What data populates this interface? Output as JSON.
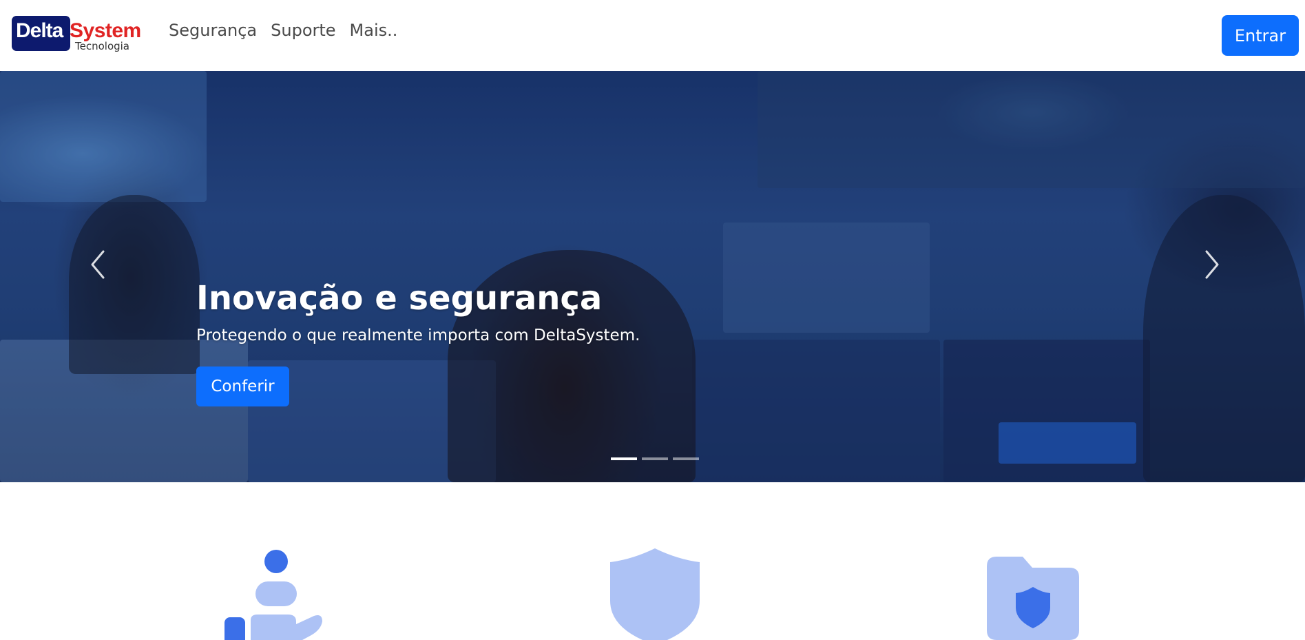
{
  "navbar": {
    "logo": {
      "brand_part1": "Delta",
      "brand_part2": "System",
      "tagline": "Tecnologia"
    },
    "links": [
      {
        "label": "Segurança"
      },
      {
        "label": "Suporte"
      },
      {
        "label": "Mais.."
      }
    ],
    "login_label": "Entrar"
  },
  "carousel": {
    "title": "Inovação e segurança",
    "subtitle": "Protegendo o que realmente importa com DeltaSystem.",
    "cta_label": "Conferir",
    "slide_count": 3,
    "active_slide": 1,
    "prev_icon": "chevron-left-icon",
    "next_icon": "chevron-right-icon"
  },
  "features": [
    {
      "icon": "hand-user-icon"
    },
    {
      "icon": "shield-icon"
    },
    {
      "icon": "folder-shield-icon"
    }
  ],
  "colors": {
    "primary": "#0d6efd",
    "icon_light": "#adc2f5",
    "icon_dark": "#3b6fe8",
    "brand_navy": "#0d1a6e",
    "brand_red": "#e02424"
  }
}
